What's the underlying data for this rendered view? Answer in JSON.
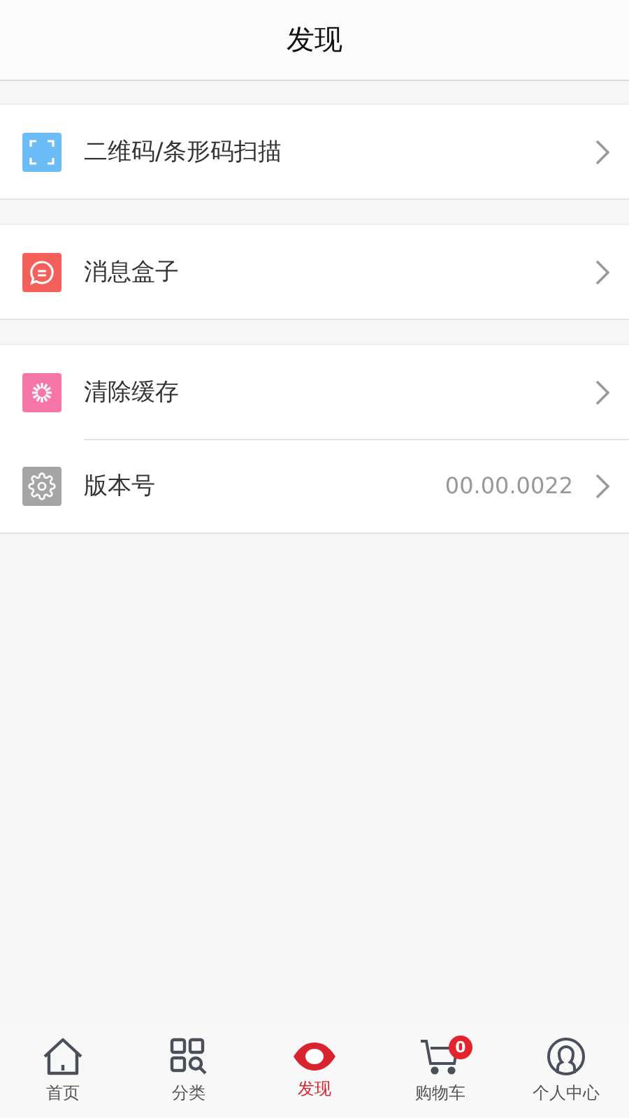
{
  "header": {
    "title": "发现"
  },
  "groups": [
    {
      "items": [
        {
          "kind": "scan",
          "color": "#6cbcf7",
          "label": "二维码/条形码扫描"
        }
      ]
    },
    {
      "items": [
        {
          "kind": "message",
          "color": "#f5605a",
          "label": "消息盒子"
        }
      ]
    },
    {
      "items": [
        {
          "kind": "burst",
          "color": "#f776a8",
          "label": "清除缓存"
        },
        {
          "kind": "gear",
          "color": "#a5a5a5",
          "label": "版本号",
          "value": "00.00.0022"
        }
      ]
    }
  ],
  "tabs": [
    {
      "kind": "home",
      "label": "首页",
      "selected": false
    },
    {
      "kind": "category",
      "label": "分类",
      "selected": false
    },
    {
      "kind": "eye",
      "label": "发现",
      "selected": true
    },
    {
      "kind": "cart",
      "label": "购物车",
      "selected": false,
      "badge": "0"
    },
    {
      "kind": "user",
      "label": "个人中心",
      "selected": false
    }
  ]
}
